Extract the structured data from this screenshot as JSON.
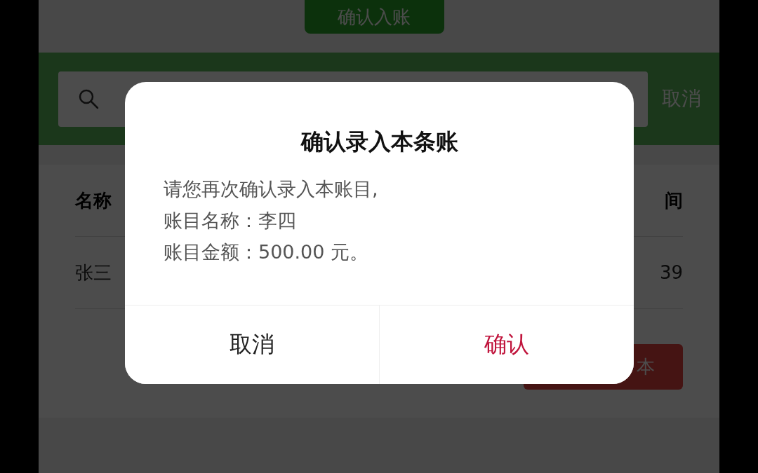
{
  "submit_button": {
    "label": "确认入账"
  },
  "search_bar": {
    "cancel": "取消"
  },
  "table": {
    "columns": [
      "名称",
      "间"
    ],
    "rows": [
      {
        "cells": [
          "张三",
          "39"
        ]
      }
    ]
  },
  "action_button": {
    "label": "本"
  },
  "dialog": {
    "title": "确认录入本条账",
    "message_lines": [
      "请您再次确认录入本账目,",
      "账目名称：李四",
      "账目金额：500.00 元。"
    ],
    "buttons": [
      {
        "label": "取消",
        "kind": "cancel"
      },
      {
        "label": "确认",
        "kind": "confirm"
      }
    ]
  }
}
